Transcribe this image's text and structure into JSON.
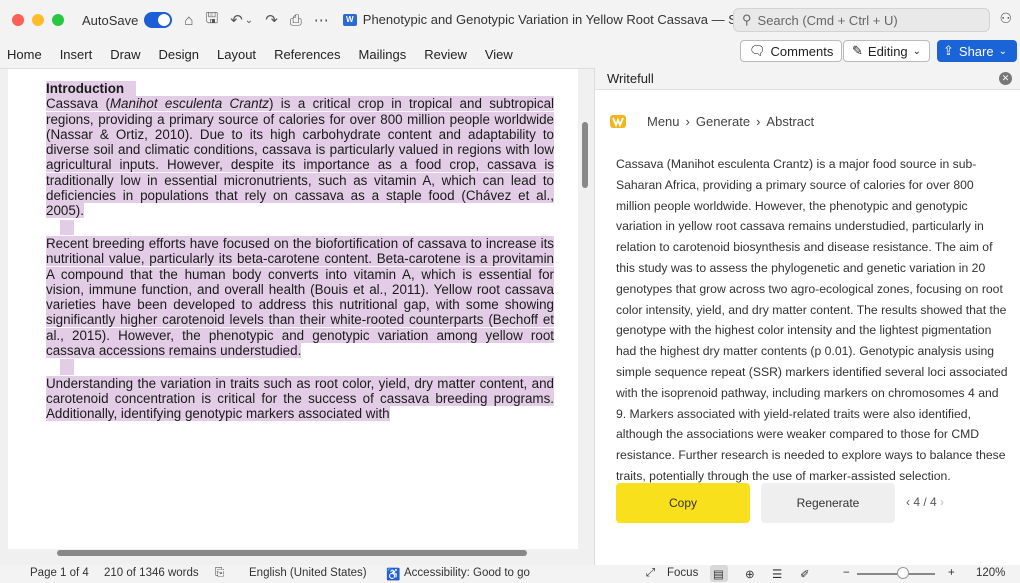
{
  "titlebar": {
    "autosave_label": "AutoSave",
    "doc_title": "Phenotypic and Genotypic Variation in Yellow Root Cassava — Saved ⌄",
    "search_placeholder": "Search (Cmd + Ctrl + U)",
    "word_badge": "W"
  },
  "ribbon": {
    "tabs": [
      "Home",
      "Insert",
      "Draw",
      "Design",
      "Layout",
      "References",
      "Mailings",
      "Review",
      "View"
    ],
    "comments_label": "Comments",
    "editing_label": "Editing",
    "share_label": "Share"
  },
  "document": {
    "heading": "Introduction",
    "p1_a": "Cassava (",
    "p1_italic": "Manihot esculenta Crantz",
    "p1_b": ") is a critical crop in tropical and subtropical regions, providing a primary source of calories for over 800 million people worldwide (Nassar & Ortiz, 2010). Due to its high carbohydrate content and adaptability to diverse soil and climatic conditions, cassava is particularly valued in regions with low agricultural inputs. However, despite its importance as a food crop, cassava is traditionally low in essential micronutrients, such as vitamin A, which can lead to deficiencies in populations that rely on cassava as a staple food (Chávez et al., 2005).",
    "p2": "Recent breeding efforts have focused on the biofortification of cassava to increase its nutritional value, particularly its beta-carotene content. Beta-carotene is a provitamin A compound that the human body converts into vitamin A, which is essential for vision, immune function, and overall health (Bouis et al., 2011). Yellow root cassava varieties have been developed to address this nutritional gap, with some showing significantly higher carotenoid levels than their white-rooted counterparts (Bechoff et al., 2015). However, the phenotypic and genotypic variation among yellow root cassava accessions remains understudied.",
    "p3": "Understanding the variation in traits such as root color, yield, dry matter content, and carotenoid concentration is critical for the success of cassava breeding programs. Additionally, identifying genotypic markers associated with"
  },
  "pane": {
    "title": "Writefull",
    "crumb_menu": "Menu",
    "crumb_generate": "Generate",
    "crumb_abstract": "Abstract",
    "crumb_sep": "›",
    "abstract": "Cassava (Manihot esculenta Crantz) is a major food source in sub-Saharan Africa, providing a primary source of calories for over 800 million people worldwide. However, the phenotypic and genotypic variation in yellow root cassava remains understudied, particularly in relation to carotenoid biosynthesis and disease resistance. The aim of this study was to assess the phylogenetic and genetic variation in 20 genotypes that grow across two agro-ecological zones, focusing on root color intensity, yield, and dry matter content. The results showed that the genotype with the highest color intensity and the lightest pigmentation had the highest dry matter contents (p 0.01). Genotypic analysis using simple sequence repeat (SSR) markers identified several loci associated with the isoprenoid pathway, including markers on chromosomes 4 and 9. Markers associated with yield-related traits were also identified, although the associations were weaker compared to those for CMD resistance. Further research is needed to explore ways to balance these traits, potentially through the use of marker-assisted selection.",
    "copy_label": "Copy",
    "regenerate_label": "Regenerate",
    "pager_prev": "‹",
    "pager_text": "4 / 4",
    "pager_next": "›"
  },
  "statusbar": {
    "page": "Page 1 of 4",
    "words": "210 of 1346 words",
    "language": "English (United States)",
    "accessibility": "Accessibility: Good to go",
    "focus": "Focus",
    "zoom": "120%"
  },
  "colors": {
    "highlight": "#e3cde6",
    "share_blue": "#1a64d8",
    "copy_yellow": "#f8e01c",
    "traffic_red": "#ff5f57",
    "traffic_yellow": "#febc2e",
    "traffic_green": "#28c840"
  }
}
